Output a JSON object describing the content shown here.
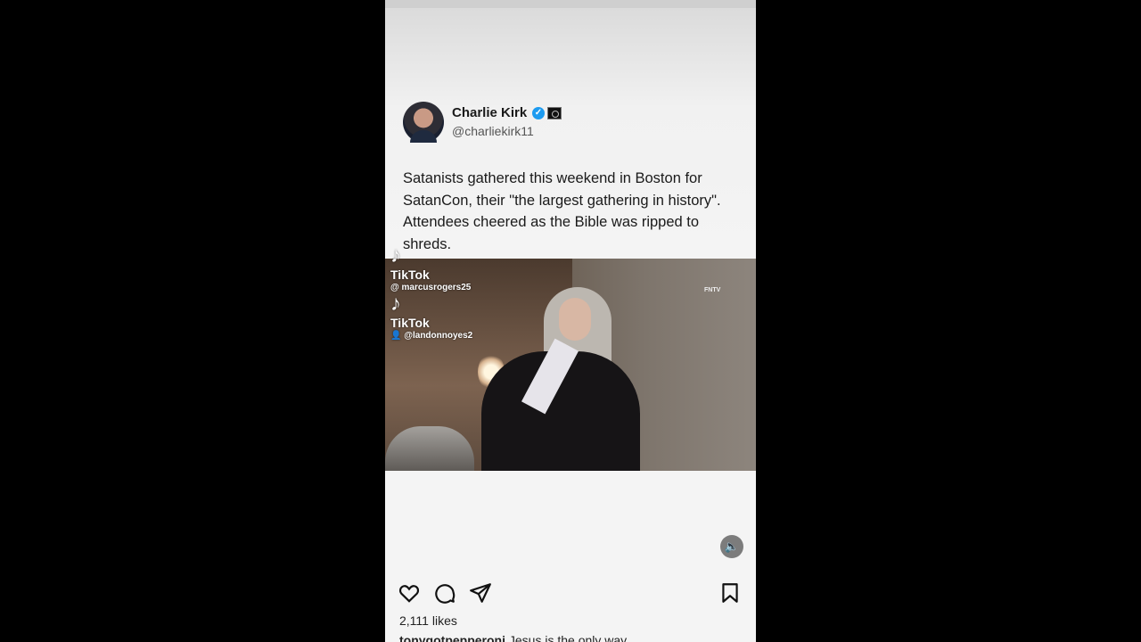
{
  "tweet": {
    "author_name": "Charlie Kirk",
    "handle": "@charliekirk11",
    "verified_icon": "verified-check-icon",
    "text": "Satanists gathered this weekend in Boston for SatanCon, their \"the largest gathering in history\". Attendees cheered as the Bible was ripped to shreds."
  },
  "video": {
    "watermark": "FNTV",
    "tiktok_marks": [
      {
        "brand": "TikTok",
        "user": "@ marcusrogers25"
      },
      {
        "brand": "TikTok",
        "user": "👤 @landonnoyes2"
      }
    ]
  },
  "actions": {
    "icons": [
      "heart-icon",
      "comment-icon",
      "share-icon",
      "bookmark-icon"
    ],
    "mute_icon": "speaker-icon"
  },
  "post": {
    "likes": "2,111 likes",
    "caption_user": "tonygotpepperoni",
    "caption_text": " Jesus is the only way"
  },
  "colors": {
    "background": "#000000",
    "verified": "#1d9bf0"
  }
}
